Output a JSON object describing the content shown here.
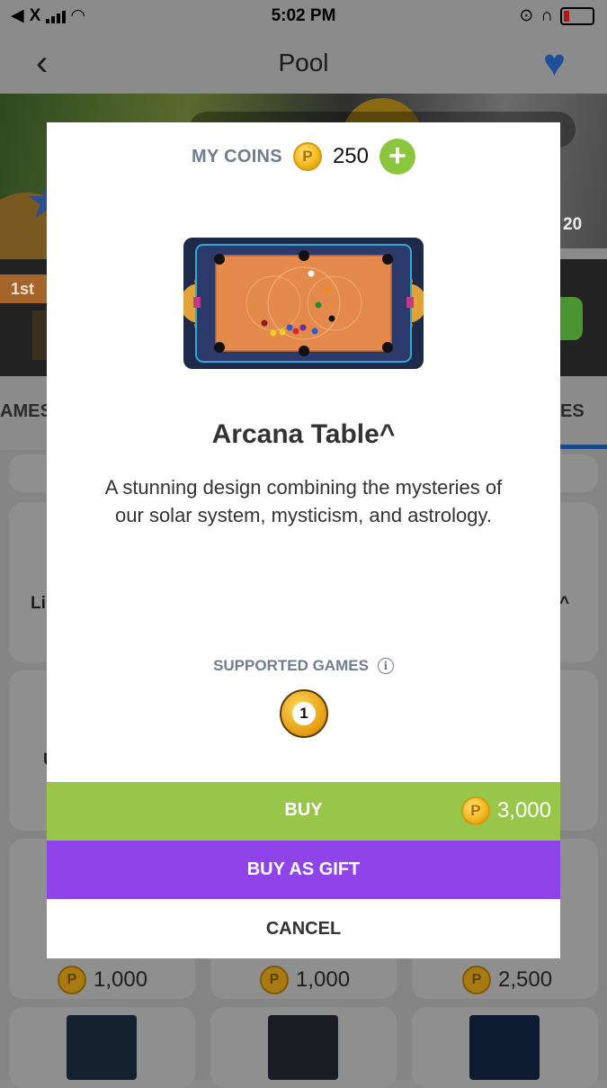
{
  "status_bar": {
    "carrier": "X",
    "time": "5:02 PM"
  },
  "nav": {
    "title": "Pool"
  },
  "background": {
    "hero_badge": "20",
    "rank_tag": "1st",
    "tab_left": "AMES",
    "tab_right": "ES",
    "row_left_text": "Li",
    "row_right_text": "^",
    "row2_left_text": "U",
    "prices": [
      "1,000",
      "1,000",
      "2,500"
    ]
  },
  "modal": {
    "coins_label": "MY COINS",
    "coins_value": "250",
    "coin_symbol": "P",
    "item_title": "Arcana Table^",
    "item_description": "A stunning design combining the mysteries of our solar system, mysticism, and astrology.",
    "supported_games_label": "SUPPORTED GAMES",
    "supported_game_ball": "1",
    "buy_label": "BUY",
    "buy_price": "3,000",
    "gift_label": "BUY AS GIFT",
    "cancel_label": "CANCEL"
  },
  "colors": {
    "buy_green": "#98c64a",
    "gift_purple": "#8e44e8",
    "label_gray": "#6f7d92",
    "plus_green": "#8cc63f",
    "coin_gold": "#f0b51a"
  }
}
